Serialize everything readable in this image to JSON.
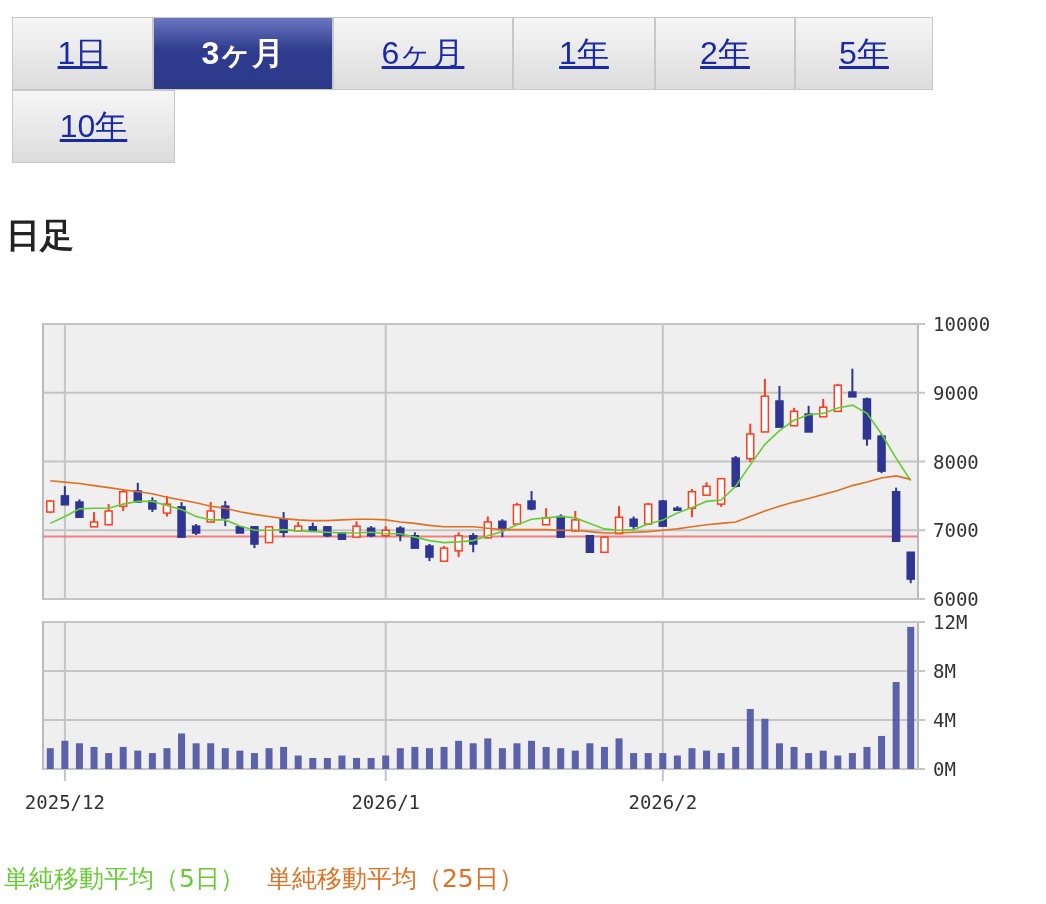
{
  "tabs": [
    {
      "label": "1日",
      "selected": false
    },
    {
      "label": "3ヶ月",
      "selected": true
    },
    {
      "label": "6ヶ月",
      "selected": false
    },
    {
      "label": "1年",
      "selected": false
    },
    {
      "label": "2年",
      "selected": false
    },
    {
      "label": "5年",
      "selected": false
    },
    {
      "label": "10年",
      "selected": false
    }
  ],
  "heading": "日足",
  "price_chart": {
    "chart_data": {
      "type": "candlestick",
      "ylim": [
        6000,
        10000
      ],
      "grid": true,
      "categories": [
        null,
        null,
        null,
        null,
        null,
        null,
        null,
        null,
        null,
        null,
        null,
        null,
        null,
        null,
        null,
        null,
        null,
        null,
        null,
        null,
        null,
        null,
        null,
        null,
        null,
        null,
        null,
        null,
        null,
        null,
        null,
        null,
        null,
        null,
        null,
        null,
        null,
        null,
        null,
        null,
        null,
        null,
        null,
        null,
        null,
        null,
        null,
        null,
        null,
        null,
        null,
        null,
        null,
        null,
        null,
        null,
        null,
        null,
        null,
        null
      ],
      "yticks": [
        6000,
        7000,
        8000,
        9000,
        10000
      ],
      "ref_lines": [
        {
          "axis": "y",
          "value": 6910
        }
      ],
      "ohlc": [
        [
          7265,
          7440,
          7250,
          7425
        ],
        [
          7500,
          7640,
          7370,
          7370
        ],
        [
          7410,
          7450,
          7180,
          7190
        ],
        [
          7050,
          7265,
          7050,
          7120
        ],
        [
          7080,
          7380,
          7080,
          7280
        ],
        [
          7350,
          7600,
          7280,
          7560
        ],
        [
          7570,
          7690,
          7410,
          7410
        ],
        [
          7425,
          7480,
          7265,
          7310
        ],
        [
          7250,
          7500,
          7200,
          7380
        ],
        [
          7340,
          7410,
          6900,
          6900
        ],
        [
          7060,
          7090,
          6930,
          6960
        ],
        [
          7120,
          7410,
          7120,
          7280
        ],
        [
          7350,
          7425,
          7060,
          7180
        ],
        [
          7050,
          7050,
          6960,
          6960
        ],
        [
          7050,
          7060,
          6740,
          6800
        ],
        [
          6820,
          7060,
          6820,
          7050
        ],
        [
          7160,
          7265,
          6900,
          6970
        ],
        [
          6990,
          7120,
          6990,
          7060
        ],
        [
          7050,
          7110,
          7000,
          7000
        ],
        [
          7050,
          7060,
          6900,
          6920
        ],
        [
          6960,
          6970,
          6860,
          6870
        ],
        [
          6900,
          7130,
          6900,
          7060
        ],
        [
          7030,
          7060,
          6900,
          6920
        ],
        [
          6920,
          7060,
          6900,
          7000
        ],
        [
          7030,
          7060,
          6840,
          6930
        ],
        [
          6920,
          6970,
          6740,
          6740
        ],
        [
          6770,
          6800,
          6550,
          6610
        ],
        [
          6550,
          6770,
          6550,
          6740
        ],
        [
          6700,
          6970,
          6610,
          6920
        ],
        [
          6920,
          6960,
          6680,
          6800
        ],
        [
          6890,
          7200,
          6890,
          7120
        ],
        [
          7130,
          7160,
          6900,
          7020
        ],
        [
          7090,
          7400,
          7090,
          7370
        ],
        [
          7425,
          7570,
          7290,
          7310
        ],
        [
          7080,
          7320,
          7080,
          7180
        ],
        [
          7200,
          7230,
          6900,
          6900
        ],
        [
          6990,
          7280,
          6980,
          7150
        ],
        [
          6920,
          6930,
          6680,
          6680
        ],
        [
          6680,
          6910,
          6680,
          6900
        ],
        [
          6950,
          7350,
          6950,
          7190
        ],
        [
          7160,
          7200,
          7000,
          7060
        ],
        [
          7090,
          7400,
          7090,
          7380
        ],
        [
          7425,
          7440,
          7060,
          7060
        ],
        [
          7320,
          7350,
          7280,
          7300
        ],
        [
          7320,
          7600,
          7190,
          7560
        ],
        [
          7510,
          7700,
          7510,
          7640
        ],
        [
          7380,
          7750,
          7340,
          7750
        ],
        [
          8050,
          8080,
          7620,
          7640
        ],
        [
          8040,
          8550,
          7990,
          8400
        ],
        [
          8430,
          9200,
          8430,
          8950
        ],
        [
          8880,
          9100,
          8500,
          8500
        ],
        [
          8520,
          8780,
          8520,
          8730
        ],
        [
          8690,
          8810,
          8430,
          8430
        ],
        [
          8650,
          8910,
          8650,
          8790
        ],
        [
          8730,
          9130,
          8730,
          9110
        ],
        [
          9010,
          9350,
          8940,
          8940
        ],
        [
          8910,
          8930,
          8230,
          8330
        ],
        [
          8370,
          8400,
          7830,
          7860
        ],
        [
          7560,
          7620,
          6840,
          6840
        ],
        [
          6680,
          6680,
          6230,
          6290
        ]
      ],
      "series": [
        {
          "name": "単純移動平均（5日）",
          "type": "line",
          "color": "#66cc33",
          "values": [
            7100,
            7200,
            7310,
            7320,
            7320,
            7380,
            7420,
            7420,
            7360,
            7300,
            7200,
            7150,
            7150,
            7060,
            7000,
            7000,
            7010,
            6990,
            6980,
            6970,
            6960,
            6960,
            6970,
            6950,
            6950,
            6900,
            6850,
            6820,
            6830,
            6850,
            6920,
            6980,
            7080,
            7160,
            7180,
            7200,
            7180,
            7100,
            7020,
            7000,
            7010,
            7090,
            7150,
            7250,
            7330,
            7420,
            7440,
            7640,
            7950,
            8250,
            8450,
            8600,
            8680,
            8700,
            8780,
            8820,
            8700,
            8400,
            8050,
            7720
          ]
        },
        {
          "name": "単純移動平均（25日）",
          "type": "line",
          "color": "#e07020",
          "values": [
            7720,
            7700,
            7680,
            7650,
            7620,
            7590,
            7560,
            7530,
            7480,
            7440,
            7400,
            7350,
            7320,
            7270,
            7230,
            7200,
            7170,
            7150,
            7140,
            7140,
            7150,
            7160,
            7160,
            7150,
            7120,
            7100,
            7070,
            7050,
            7050,
            7050,
            7030,
            7010,
            7010,
            7010,
            7010,
            7000,
            7000,
            6980,
            6960,
            6960,
            6970,
            6980,
            7000,
            7020,
            7050,
            7080,
            7100,
            7120,
            7200,
            7280,
            7350,
            7410,
            7460,
            7520,
            7580,
            7650,
            7700,
            7760,
            7790,
            7740
          ]
        }
      ]
    }
  },
  "volume_chart": {
    "chart_data": {
      "type": "bar",
      "ylim": [
        0,
        12
      ],
      "grid": true,
      "categories": [
        null,
        "2025/12",
        null,
        null,
        null,
        null,
        null,
        null,
        null,
        null,
        null,
        null,
        null,
        null,
        null,
        null,
        null,
        null,
        null,
        null,
        null,
        null,
        null,
        "2026/1",
        null,
        null,
        null,
        null,
        null,
        null,
        null,
        null,
        null,
        null,
        null,
        null,
        null,
        null,
        null,
        null,
        null,
        null,
        "2026/2",
        null,
        null,
        null,
        null,
        null,
        null,
        null,
        null,
        null,
        null,
        null,
        null,
        null,
        null,
        null,
        null,
        null
      ],
      "yticks": [
        {
          "value": 0,
          "label": "0M"
        },
        {
          "value": 4,
          "label": "4M"
        },
        {
          "value": 8,
          "label": "8M"
        },
        {
          "value": 12,
          "label": "12M"
        }
      ],
      "values": [
        1.7,
        2.3,
        2.1,
        1.8,
        1.3,
        1.8,
        1.5,
        1.3,
        1.7,
        2.9,
        2.1,
        2.1,
        1.7,
        1.5,
        1.3,
        1.7,
        1.8,
        1.1,
        0.9,
        0.9,
        1.1,
        0.9,
        0.9,
        1.1,
        1.7,
        1.8,
        1.7,
        1.8,
        2.3,
        2.1,
        2.5,
        1.7,
        2.1,
        2.3,
        1.8,
        1.7,
        1.5,
        2.1,
        1.8,
        2.5,
        1.3,
        1.3,
        1.3,
        1.1,
        1.7,
        1.5,
        1.3,
        1.8,
        4.9,
        4.1,
        2.1,
        1.8,
        1.3,
        1.5,
        1.1,
        1.3,
        1.8,
        2.7,
        7.1,
        11.6
      ]
    }
  }
}
